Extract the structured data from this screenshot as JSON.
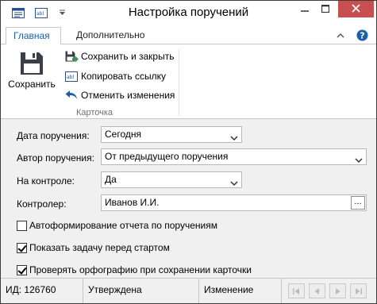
{
  "window": {
    "title": "Настройка поручений"
  },
  "titlebar": {
    "icons": [
      "card-icon",
      "field-icon",
      "customize-arrow-icon"
    ],
    "controls": [
      "minimize-icon",
      "maximize-icon",
      "close-icon"
    ]
  },
  "tabs": [
    {
      "label": "Главная",
      "active": true
    },
    {
      "label": "Дополнительно",
      "active": false
    }
  ],
  "ribbon": {
    "save_label": "Сохранить",
    "save_close_label": "Сохранить и закрыть",
    "copy_link_label": "Копировать ссылку",
    "undo_label": "Отменить изменения",
    "group_label": "Карточка"
  },
  "form": {
    "date_label": "Дата поручения:",
    "date_value": "Сегодня",
    "author_label": "Автор поручения:",
    "author_value": "От предыдущего поручения",
    "control_label": "На контроле:",
    "control_value": "Да",
    "controller_label": "Контролер:",
    "controller_value": "Иванов И.И.",
    "controller_button": "...",
    "checks": [
      {
        "label": "Автоформирование отчета по поручениям",
        "checked": false
      },
      {
        "label": "Показать задачу перед стартом",
        "checked": true
      },
      {
        "label": "Проверять орфографию при сохранении карточки",
        "checked": true
      }
    ]
  },
  "statusbar": {
    "id_text": "ИД: 126760",
    "state_text": "Утверждена",
    "mode_text": "Изменение"
  },
  "colors": {
    "accent": "#1a5fa8",
    "close": "#c74f4f",
    "save_icon": "#3a3f4a"
  }
}
